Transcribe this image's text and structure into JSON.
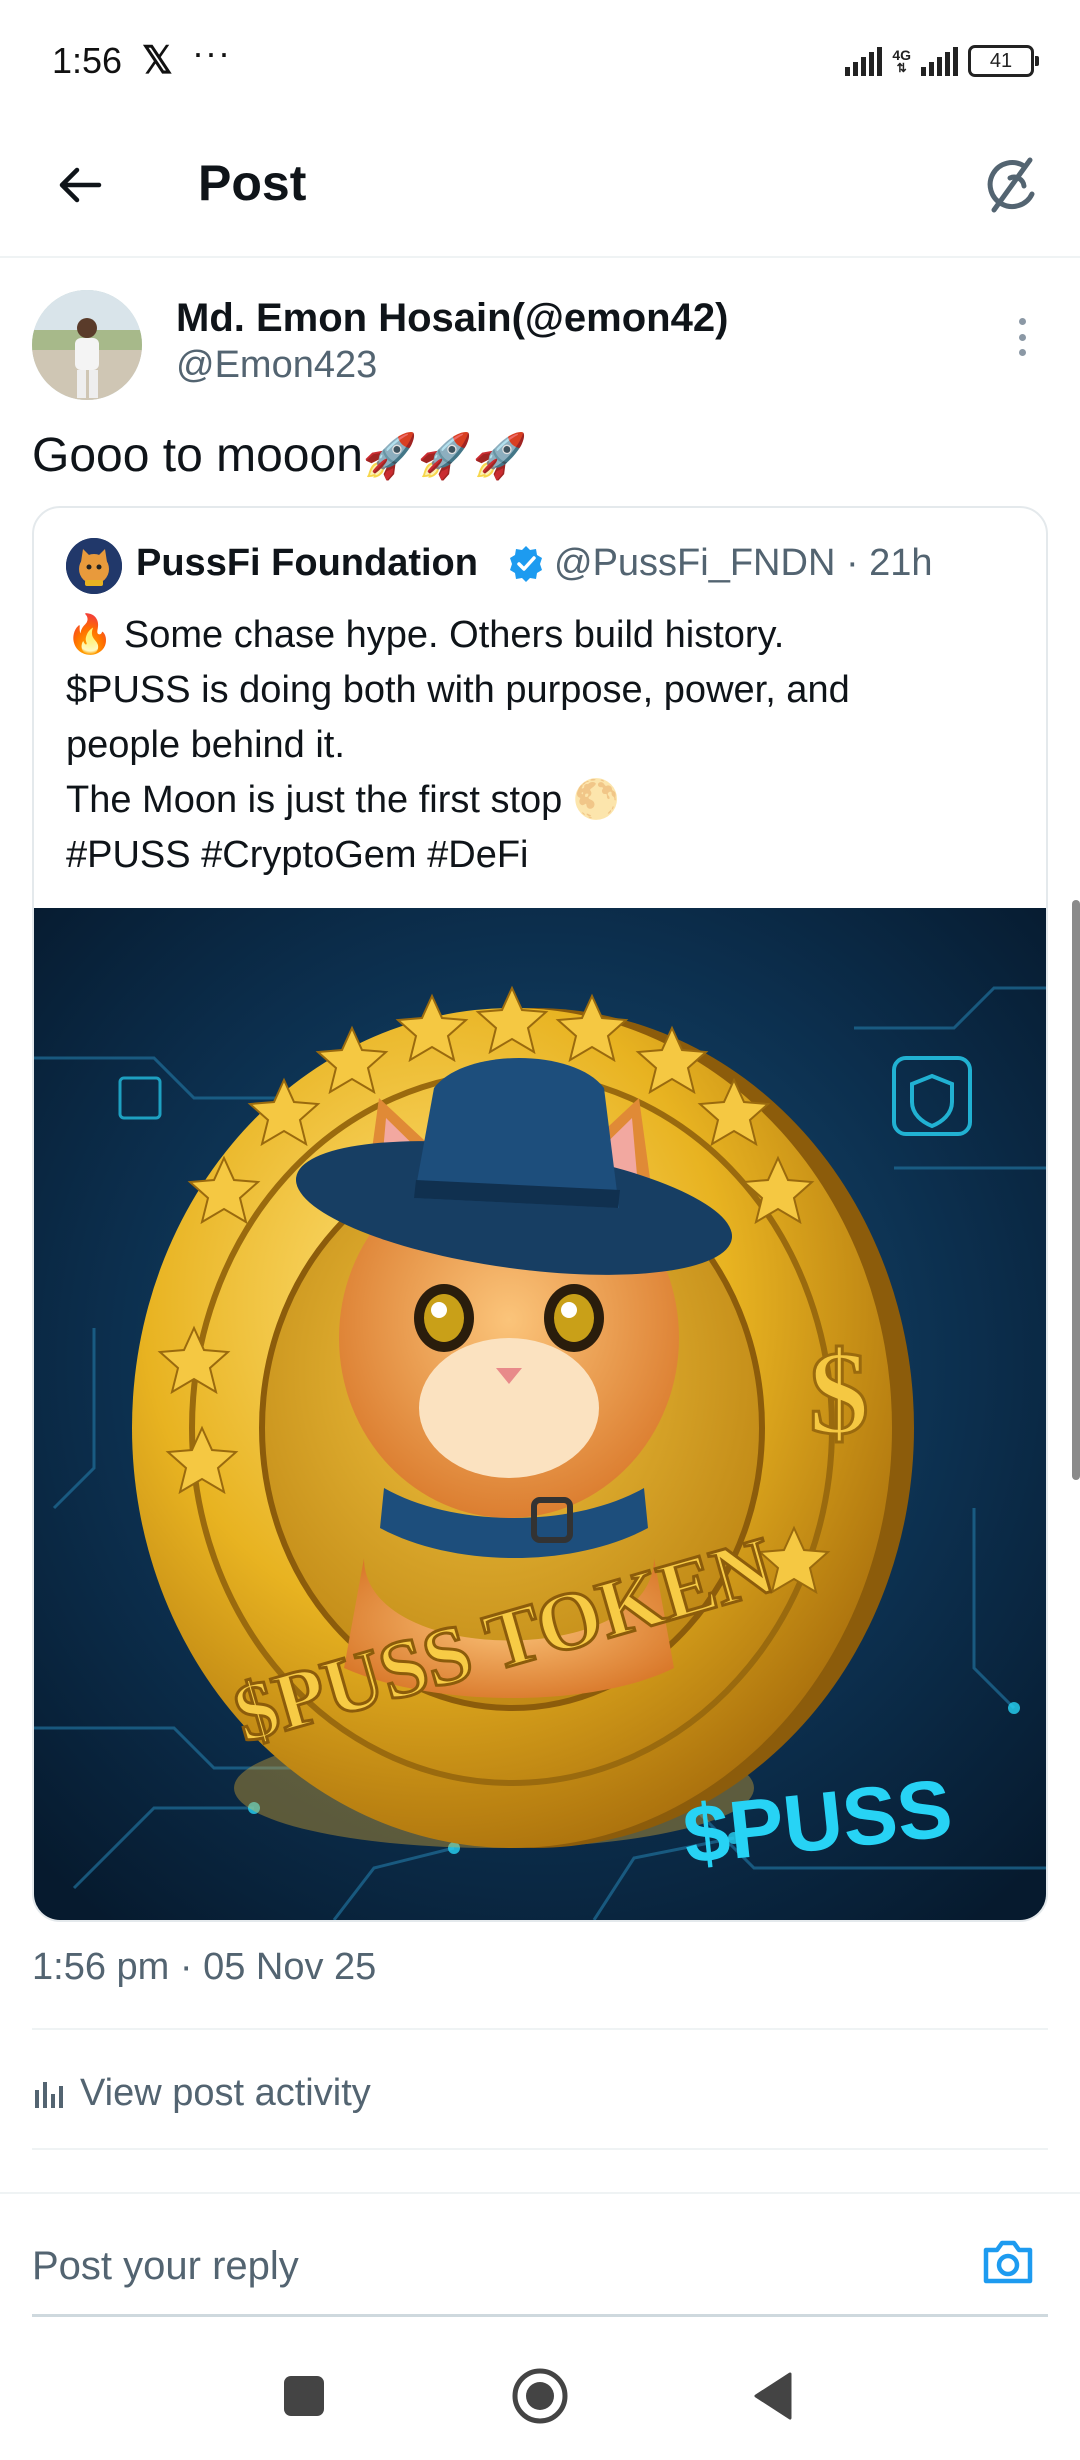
{
  "status_bar": {
    "time": "1:56",
    "x_logo": "𝕏",
    "dots": "···",
    "network": "4G",
    "battery": "41"
  },
  "header": {
    "title": "Post",
    "back_icon": "arrow-left-icon",
    "grok_icon": "grok-icon"
  },
  "post": {
    "author_name": "Md. Emon Hosain(@emon42)",
    "author_handle": "@Emon423",
    "text": "Gooo to mooon",
    "emojis": "🚀🚀🚀",
    "timestamp": "1:56 pm · 05 Nov 25"
  },
  "quote": {
    "name": "PussFi Foundation",
    "handle_time": "@PussFi_FNDN · 21h",
    "lines": [
      "🔥 Some chase hype. Others build history.",
      "$PUSS is doing both with purpose, power, and",
      "people behind it.",
      "The Moon is just the first stop 🌕",
      "#PUSS #CryptoGem #DeFi"
    ],
    "image": {
      "coin_text": "$PUSS TOKEN",
      "side_text": "$PUSS",
      "dollar": "$"
    }
  },
  "activity": {
    "label": "View post activity",
    "icon": "bar-chart-icon"
  },
  "reply": {
    "placeholder": "Post your reply",
    "camera_icon": "camera-icon"
  },
  "colors": {
    "accent": "#1d9bf0",
    "secondary_text": "#536471",
    "coin_gold": "#e8b321",
    "image_bg": "#0b2a48",
    "neon": "#27d3f5"
  }
}
